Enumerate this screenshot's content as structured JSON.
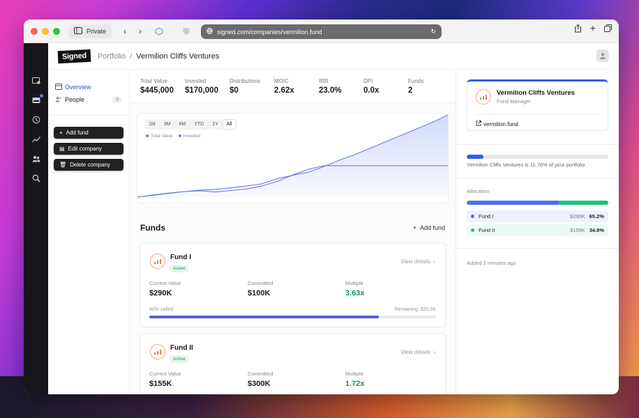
{
  "browser": {
    "private_label": "Private",
    "url": "signed.com/companies/vermilion.fund"
  },
  "app": {
    "logo": "Signed",
    "breadcrumb_parent": "Portfolio",
    "breadcrumb_separator": "/",
    "breadcrumb_current": "Vermilion Cliffs Ventures"
  },
  "left_nav": {
    "overview": "Overview",
    "people": "People",
    "people_count": "0",
    "actions": [
      "Add fund",
      "Edit company",
      "Delete company"
    ]
  },
  "stats": [
    {
      "label": "Total Value",
      "value": "$445,000"
    },
    {
      "label": "Invested",
      "value": "$170,000"
    },
    {
      "label": "Distributions",
      "value": "$0"
    },
    {
      "label": "MOIC",
      "value": "2.62x"
    },
    {
      "label": "IRR",
      "value": "23.0%"
    },
    {
      "label": "DPI",
      "value": "0.0x"
    },
    {
      "label": "Funds",
      "value": "2"
    }
  ],
  "chart": {
    "ranges": [
      "1M",
      "3M",
      "6M",
      "YTD",
      "1Y",
      "All"
    ],
    "selected_range": "All",
    "legend": [
      "Total Value",
      "Invested"
    ],
    "colors": {
      "total": "#5b7ff0",
      "invested": "#8b6be0"
    }
  },
  "chart_data": {
    "type": "area",
    "x": [
      0,
      1,
      2,
      3,
      4,
      5,
      6,
      7,
      8,
      9,
      10,
      11,
      12,
      13,
      14,
      15,
      16,
      17,
      18,
      19,
      20
    ],
    "series": [
      {
        "name": "Total Value",
        "values": [
          0,
          10,
          20,
          30,
          38,
          42,
          50,
          60,
          72,
          100,
          118,
          135,
          165,
          200,
          230,
          265,
          300,
          335,
          370,
          405,
          445
        ]
      },
      {
        "name": "Invested",
        "values": [
          0,
          12,
          22,
          30,
          34,
          28,
          36,
          44,
          60,
          85,
          120,
          150,
          170,
          170,
          170,
          170,
          170,
          170,
          170,
          170,
          170
        ]
      }
    ],
    "ylim": [
      0,
      445
    ]
  },
  "funds": {
    "title": "Funds",
    "add_label": "Add fund",
    "view_label": "View details",
    "labels": {
      "current": "Current Value",
      "committed": "Committed",
      "multiple": "Multiple"
    },
    "items": [
      {
        "name": "Fund I",
        "status": "Active",
        "current": "$290K",
        "committed": "$100K",
        "multiple": "3.63x",
        "called": "80% called",
        "remaining": "Remaining: $20.0K",
        "progress": 0.8
      },
      {
        "name": "Fund II",
        "status": "Active",
        "current": "$155K",
        "committed": "$300K",
        "multiple": "1.72x"
      }
    ]
  },
  "company": {
    "name": "Vermilion Cliffs Ventures",
    "role": "Fund Manager",
    "link": "vermilion.fund",
    "portfolio_share": 0.1176,
    "portfolio_text": "Vermilion Cliffs Ventures is 11.76% of your portfolio."
  },
  "allocation": {
    "title": "Allocation",
    "items": [
      {
        "name": "Fund I",
        "amount": "$290K",
        "pct": "65.2%",
        "share": 0.652,
        "color": "#4f6ff0",
        "bg": "#eef1fd"
      },
      {
        "name": "Fund II",
        "amount": "$155K",
        "pct": "34.8%",
        "share": 0.348,
        "color": "#22c07a",
        "bg": "#edfaf3"
      }
    ]
  },
  "added": "Added 2 minutes ago"
}
